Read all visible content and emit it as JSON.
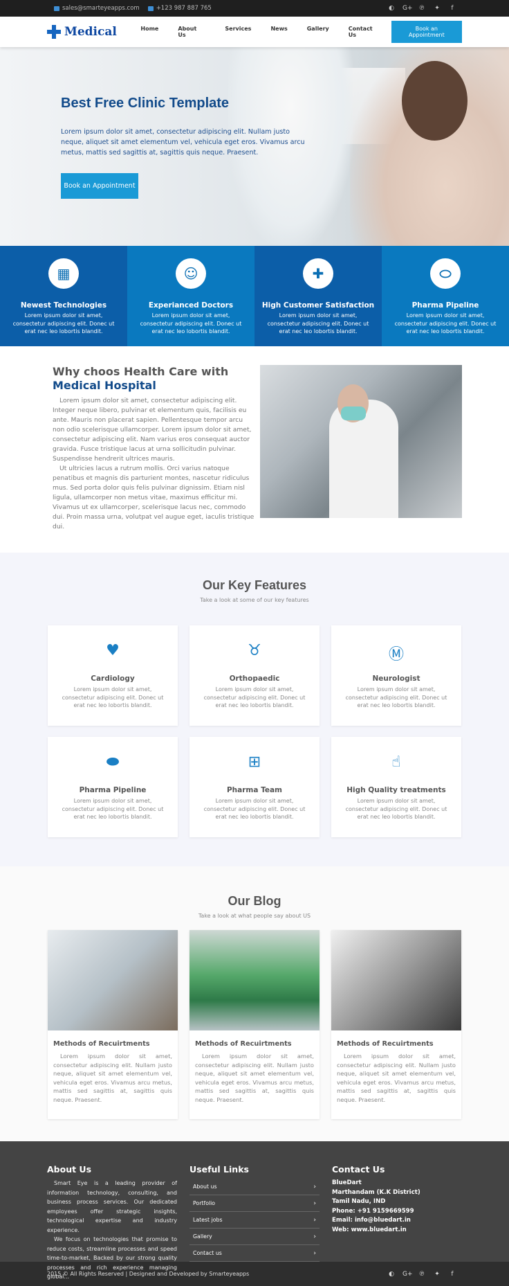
{
  "topbar": {
    "email": "sales@smarteyeapps.com",
    "phone": "+123 987 887 765",
    "socials": [
      "github-icon",
      "google-plus-icon",
      "pinterest-icon",
      "twitter-icon",
      "facebook-icon"
    ],
    "social_glyphs": [
      "◐",
      "G+",
      "℗",
      "✦",
      "f"
    ]
  },
  "nav": {
    "logo": "Medical",
    "items": [
      "Home",
      "About Us",
      "Services",
      "News",
      "Gallery",
      "Contact Us"
    ],
    "cta": "Book an Appointment"
  },
  "hero": {
    "title": "Best Free Clinic Template",
    "body": "Lorem ipsum dolor sit amet, consectetur adipiscing elit. Nullam justo neque, aliquet sit amet elementum vel, vehicula eget eros. Vivamus arcu metus, mattis sed sagittis at, sagittis quis neque. Praesent.",
    "button": "Book an Appointment"
  },
  "strip": [
    {
      "icon": "hospital-icon",
      "glyph": "▦",
      "title": "Newest Technologies",
      "text": "Lorem ipsum dolor sit amet, consectetur adipiscing elit. Donec ut erat nec leo lobortis blandit."
    },
    {
      "icon": "doctor-icon",
      "glyph": "☺",
      "title": "Experianced Doctors",
      "text": "Lorem ipsum dolor sit amet, consectetur adipiscing elit. Donec ut erat nec leo lobortis blandit."
    },
    {
      "icon": "medkit-icon",
      "glyph": "✚",
      "title": "High Customer Satisfaction",
      "text": "Lorem ipsum dolor sit amet, consectetur adipiscing elit. Donec ut erat nec leo lobortis blandit."
    },
    {
      "icon": "pills-icon",
      "glyph": "⬭",
      "title": "Pharma Pipeline",
      "text": "Lorem ipsum dolor sit amet, consectetur adipiscing elit. Donec ut erat nec leo lobortis blandit."
    }
  ],
  "why": {
    "title": "Why choos Health Care with",
    "title2": "Medical Hospital",
    "p1": "Lorem ipsum dolor sit amet, consectetur adipiscing elit. Integer neque libero, pulvinar et elementum quis, facilisis eu ante. Mauris non placerat sapien. Pellentesque tempor arcu non odio scelerisque ullamcorper. Lorem ipsum dolor sit amet, consectetur adipiscing elit. Nam varius eros consequat auctor gravida. Fusce tristique lacus at urna sollicitudin pulvinar. Suspendisse hendrerit ultrices mauris.",
    "p2": "Ut ultricies lacus a rutrum mollis. Orci varius natoque penatibus et magnis dis parturient montes, nascetur ridiculus mus. Sed porta dolor quis felis pulvinar dignissim. Etiam nisl ligula, ullamcorper non metus vitae, maximus efficitur mi. Vivamus ut ex ullamcorper, scelerisque lacus nec, commodo dui. Proin massa urna, volutpat vel augue eget, iaculis tristique dui."
  },
  "features": {
    "title": "Our Key Features",
    "subtitle": "Take a look at some of our key features",
    "cards": [
      {
        "icon": "heartbeat-icon",
        "glyph": "♥",
        "title": "Cardiology",
        "text": "Lorem ipsum dolor sit amet, consectetur adipiscing elit. Donec ut erat nec leo lobortis blandit."
      },
      {
        "icon": "ribbon-icon",
        "glyph": "♉",
        "title": "Orthopaedic",
        "text": "Lorem ipsum dolor sit amet, consectetur adipiscing elit. Donec ut erat nec leo lobortis blandit."
      },
      {
        "icon": "brain-icon",
        "glyph": "Ⓜ",
        "title": "Neurologist",
        "text": "Lorem ipsum dolor sit amet, consectetur adipiscing elit. Donec ut erat nec leo lobortis blandit."
      },
      {
        "icon": "pills-icon",
        "glyph": "⬬",
        "title": "Pharma Pipeline",
        "text": "Lorem ipsum dolor sit amet, consectetur adipiscing elit. Donec ut erat nec leo lobortis blandit."
      },
      {
        "icon": "prescription-bottle-icon",
        "glyph": "⊞",
        "title": "Pharma Team",
        "text": "Lorem ipsum dolor sit amet, consectetur adipiscing elit. Donec ut erat nec leo lobortis blandit."
      },
      {
        "icon": "thumbs-up-icon",
        "glyph": "☝",
        "title": "High Quality treatments",
        "text": "Lorem ipsum dolor sit amet, consectetur adipiscing elit. Donec ut erat nec leo lobortis blandit."
      }
    ]
  },
  "blog": {
    "title": "Our Blog",
    "subtitle": "Take a look at what people say about US",
    "posts": [
      {
        "title": "Methods of Recuirtments",
        "text": "Lorem ipsum dolor sit amet, consectetur adipiscing elit. Nullam justo neque, aliquet sit amet elementum vel, vehicula eget eros. Vivamus arcu metus, mattis sed sagittis at, sagittis quis neque. Praesent."
      },
      {
        "title": "Methods of Recuirtments",
        "text": "Lorem ipsum dolor sit amet, consectetur adipiscing elit. Nullam justo neque, aliquet sit amet elementum vel, vehicula eget eros. Vivamus arcu metus, mattis sed sagittis at, sagittis quis neque. Praesent."
      },
      {
        "title": "Methods of Recuirtments",
        "text": "Lorem ipsum dolor sit amet, consectetur adipiscing elit. Nullam justo neque, aliquet sit amet elementum vel, vehicula eget eros. Vivamus arcu metus, mattis sed sagittis at, sagittis quis neque. Praesent."
      }
    ]
  },
  "footer": {
    "about_title": "About Us",
    "about_p1": "Smart Eye is a leading provider of information technology, consulting, and business process services. Our dedicated employees offer strategic insights, technological expertise and industry experience.",
    "about_p2": "We focus on technologies that promise to reduce costs, streamline processes and speed time-to-market, Backed by our strong quality processes and rich experience managing global...",
    "links_title": "Useful Links",
    "links": [
      "About us",
      "Portfolio",
      "Latest jobs",
      "Gallery",
      "Contact us"
    ],
    "contact_title": "Contact Us",
    "contact_lines": [
      "BlueDart",
      "Marthandam (K.K District)",
      "Tamil Nadu, IND",
      "Phone: +91 9159669599",
      "Email: info@bluedart.in",
      "Web: www.bluedart.in"
    ],
    "copyright": "2015 © All Rights Reserved | Designed and Developed by Smarteyeapps"
  }
}
